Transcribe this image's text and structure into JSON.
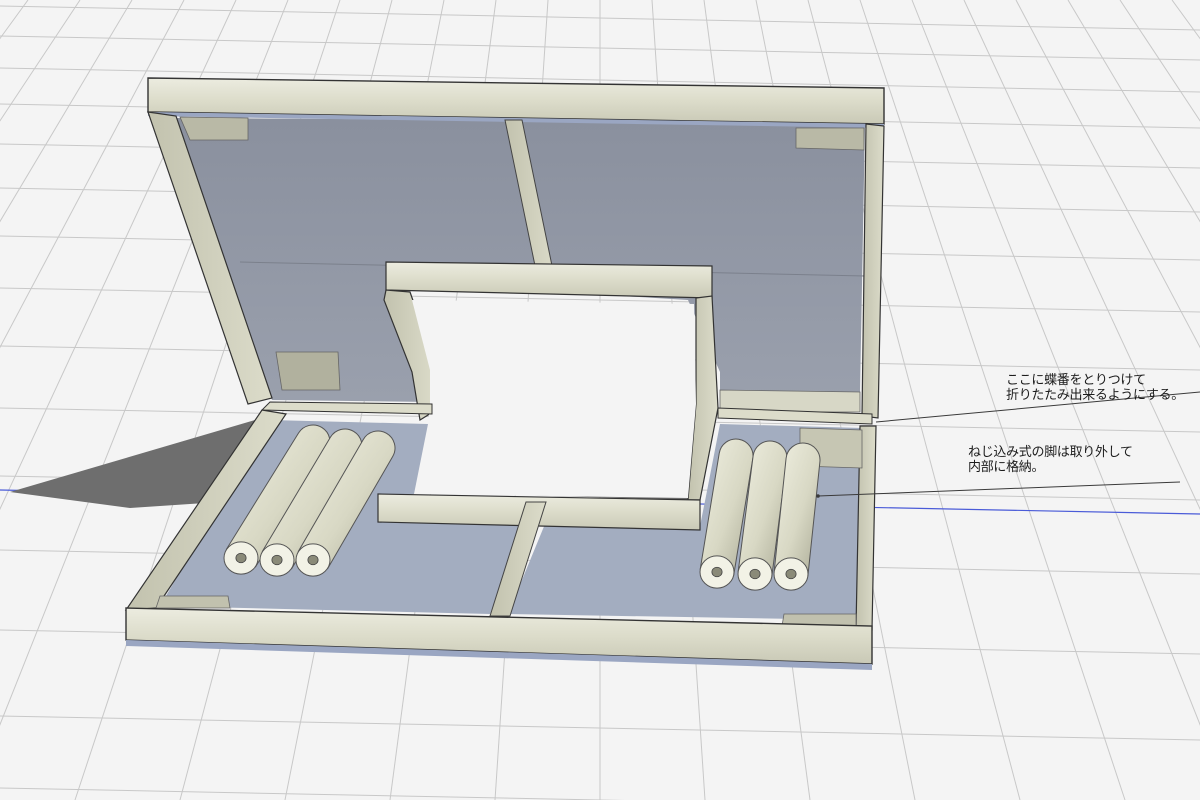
{
  "colors": {
    "background": "#f4f4f4",
    "grid_line": "#c8c8c8",
    "horizon_line": "#4a5bd8",
    "frame_wood": "#dedecc",
    "frame_wood_dark": "#b8b8a4",
    "panel_upper": "#8f95a3",
    "panel_lower": "#a3adc0",
    "shadow": "#6e6e6e",
    "pipe": "#e2e2d2",
    "pipe_shade": "#b2b29c",
    "leader_line": "#3a3a3a"
  },
  "annotations": {
    "hinge": {
      "line1": "ここに蝶番をとりつけて",
      "line2": "折りたたみ出来るようにする。"
    },
    "legs": {
      "line1": "ねじ込み式の脚は取り外して",
      "line2": "内部に格納。"
    }
  }
}
